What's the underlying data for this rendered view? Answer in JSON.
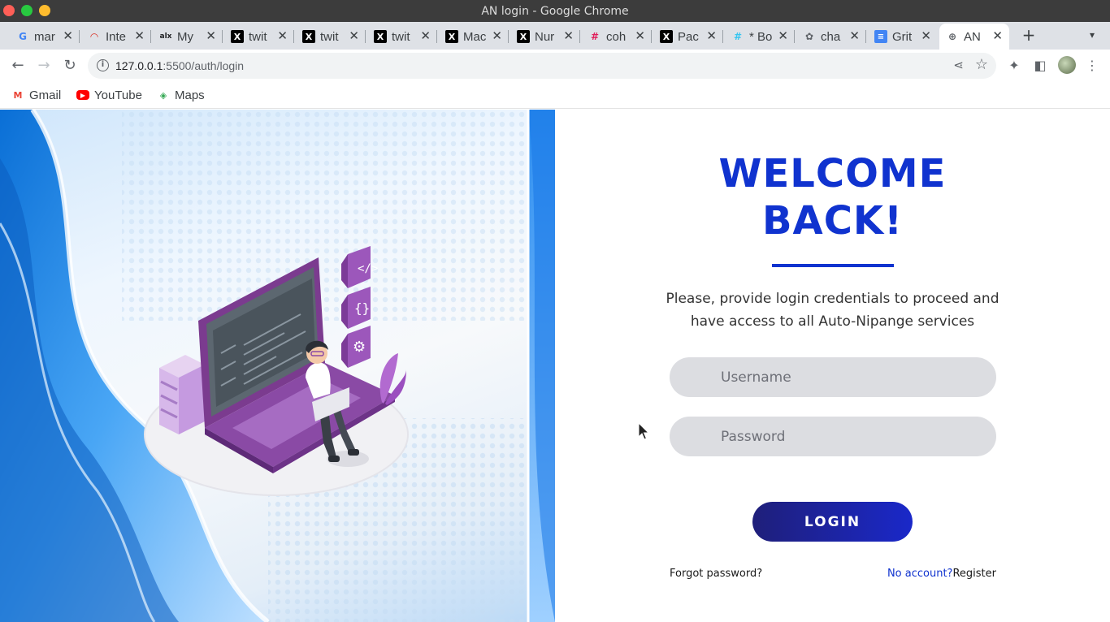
{
  "window": {
    "title": "AN login - Google Chrome"
  },
  "tabs": [
    {
      "label": "mar",
      "icon": "google-icon"
    },
    {
      "label": "Inte",
      "icon": "speedometer-icon"
    },
    {
      "label": "My",
      "icon": "alx-icon"
    },
    {
      "label": "twit",
      "icon": "x-icon"
    },
    {
      "label": "twit",
      "icon": "x-icon"
    },
    {
      "label": "twit",
      "icon": "x-icon"
    },
    {
      "label": "Mac",
      "icon": "x-icon"
    },
    {
      "label": "Nur",
      "icon": "x-icon"
    },
    {
      "label": "coh",
      "icon": "slack-icon"
    },
    {
      "label": "Pac",
      "icon": "x-icon"
    },
    {
      "label": "* Bo",
      "icon": "slack-icon"
    },
    {
      "label": "cha",
      "icon": "openai-icon"
    },
    {
      "label": "Grit",
      "icon": "docs-icon"
    },
    {
      "label": "AN",
      "icon": "globe-icon",
      "active": true
    }
  ],
  "address_bar": {
    "host": "127.0.0.1",
    "path": ":5500/auth/login"
  },
  "bookmarks": [
    {
      "label": "Gmail",
      "icon": "gmail-icon"
    },
    {
      "label": "YouTube",
      "icon": "youtube-icon"
    },
    {
      "label": "Maps",
      "icon": "maps-icon"
    }
  ],
  "login": {
    "heading_line1": "WELCOME",
    "heading_line2": "BACK!",
    "subtitle": "Please, provide login credentials to proceed and have access to all Auto-Nipange services",
    "username_placeholder": "Username",
    "password_placeholder": "Password",
    "button_label": "LOGIN",
    "forgot_label": "Forgot password?",
    "no_account_label": "No account?",
    "register_label": "Register"
  },
  "colors": {
    "accent": "#1033cf",
    "button_start": "#1f1f7a",
    "button_end": "#1a28c9",
    "field_bg": "#dcdde1"
  }
}
